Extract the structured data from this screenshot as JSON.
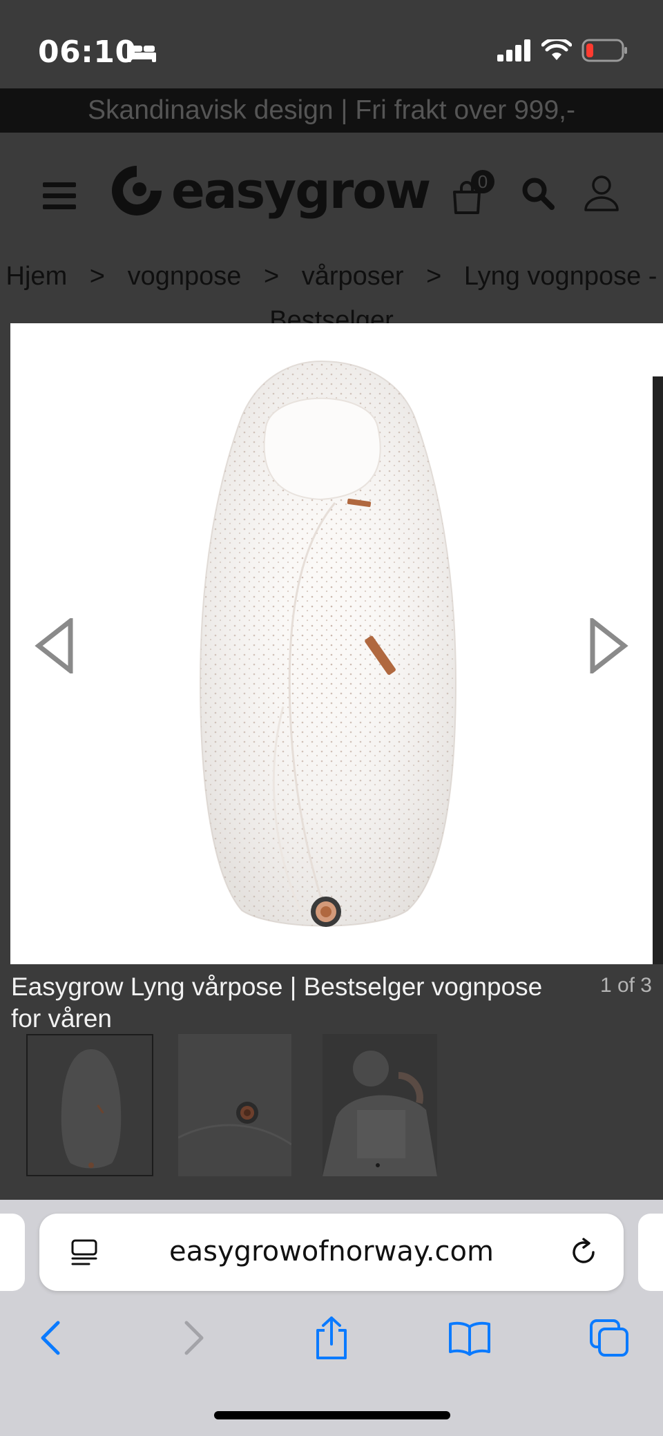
{
  "status_bar": {
    "time": "06:10",
    "icons": [
      "bed-icon",
      "cellular-signal-icon",
      "wifi-icon",
      "battery-low-icon"
    ]
  },
  "announcement": {
    "text": "Skandinavisk design | Fri frakt over 999,-"
  },
  "header": {
    "logo_text": "easygrow",
    "cart_count": "0",
    "icons": [
      "hamburger-menu-icon",
      "shopping-bag-icon",
      "search-icon",
      "user-icon"
    ]
  },
  "breadcrumb": {
    "items": [
      "Hjem",
      "vognpose",
      "vårposer",
      "Lyng vognpose - Bestselger"
    ],
    "separator": ">"
  },
  "gallery": {
    "caption": "Easygrow Lyng vårpose | Bestselger vognpose for våren",
    "counter": "1 of 3",
    "thumbnails": [
      "thumbnail-1",
      "thumbnail-2",
      "thumbnail-3"
    ],
    "selected_thumbnail": 1
  },
  "browser": {
    "url": "easygrowofnorway.com",
    "toolbar": [
      "back",
      "forward",
      "share",
      "bookmarks",
      "tabs"
    ]
  },
  "colors": {
    "overlay_background": "#3b3b3b",
    "banner_background": "#111111",
    "browser_chrome": "#d1d1d6",
    "ios_blue": "#0a7aff"
  }
}
